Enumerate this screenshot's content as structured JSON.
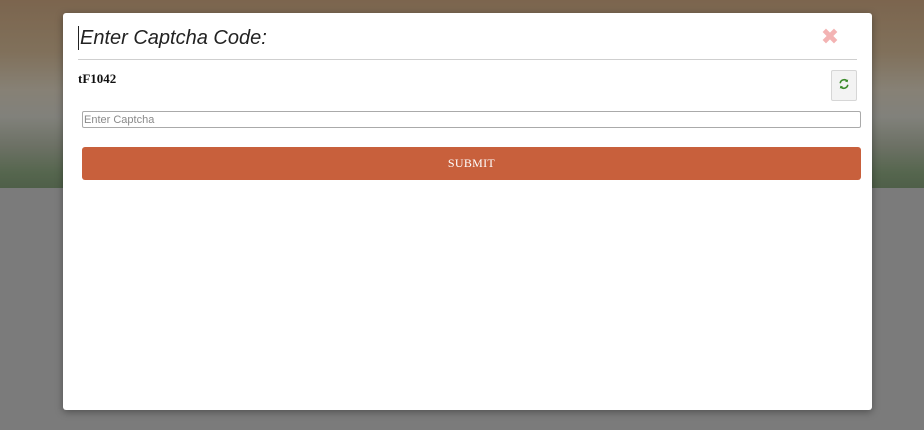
{
  "modal": {
    "title": "Enter Captcha Code:",
    "close_icon": "close-icon",
    "captcha_code": "tF1042",
    "refresh_icon": "refresh-icon",
    "input": {
      "value": "",
      "placeholder": "Enter Captcha"
    },
    "submit_label": "SUBMIT"
  },
  "colors": {
    "submit_bg": "#c8603c",
    "close_icon": "#f3b3b3",
    "refresh_icon": "#3a8a2a",
    "overlay": "#7b7b7b"
  }
}
